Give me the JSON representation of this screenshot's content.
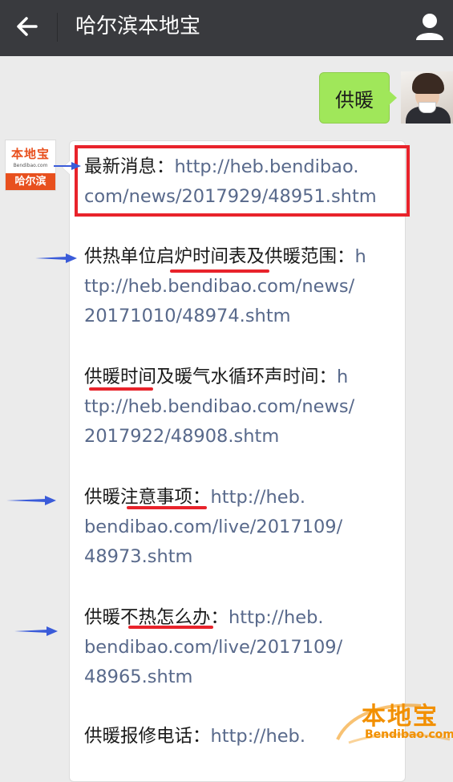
{
  "header": {
    "title": "哈尔滨本地宝",
    "back_icon": "arrow-left-icon",
    "profile_icon": "user-icon"
  },
  "sent_message": {
    "text": "供暖"
  },
  "sender_avatar": {
    "logo_main": "本地宝",
    "logo_sub": "Bendibao.com",
    "logo_city": "哈尔滨"
  },
  "reply": {
    "items": [
      {
        "label": "最新消息：",
        "lines": [
          "http://heb.bendibao.",
          "com/news/2017929/48951.shtm"
        ]
      },
      {
        "label_before": "供热单位",
        "label_hl": "启炉时间表",
        "label_after": "及供暖范围：",
        "lines": [
          "http://heb.bendibao.com/news/",
          "20171010/48974.shtm"
        ],
        "first_link": "h",
        "first_link_rest": "ttp://heb.bendibao.com/news/"
      },
      {
        "label_hl": "供暖时",
        "label_after": "间及暖气水循环声时间：",
        "first_link": "h",
        "lines": [
          "ttp://heb.bendibao.com/news/",
          "2017922/48908.shtm"
        ]
      },
      {
        "label_before": "供暖",
        "label_hl": "注意事项",
        "label_after": "：",
        "link": "http://heb.",
        "lines": [
          "bendibao.com/live/2017109/",
          "48973.shtm"
        ]
      },
      {
        "label_before": "供暖",
        "label_hl": "不热怎么办",
        "label_after": "：",
        "link": "http://heb.",
        "lines": [
          "bendibao.com/live/2017109/",
          "48965.shtm"
        ]
      },
      {
        "label": "供暖报修电话：",
        "link": "http://heb."
      }
    ]
  },
  "watermark": {
    "cn": "本地宝",
    "en": "Bendibao.com"
  },
  "colors": {
    "header_bg": "#393a3e",
    "chat_bg": "#ebebeb",
    "sent_bubble": "#a0e75a",
    "link": "#58698b",
    "annotation_red": "#e8232b",
    "annotation_arrow": "#3a5bd9",
    "brand_orange": "#e8501e"
  }
}
